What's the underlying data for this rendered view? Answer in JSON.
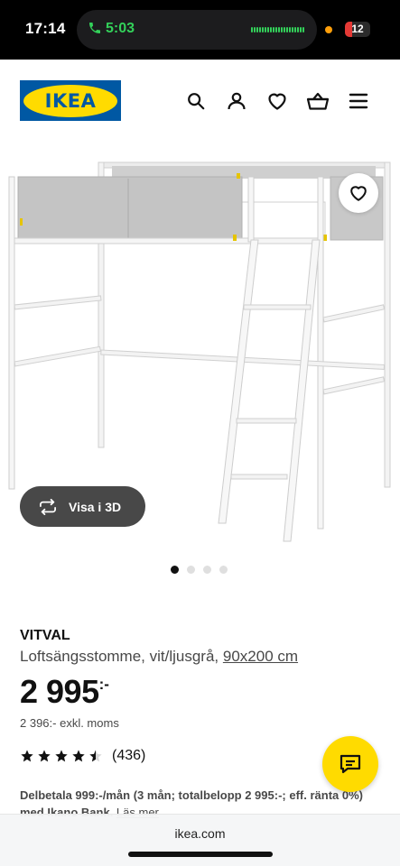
{
  "status_bar": {
    "time": "17:14",
    "call_duration": "5:03",
    "battery": "12"
  },
  "header": {
    "logo_text": "IKEA",
    "icons": [
      "search-icon",
      "profile-icon",
      "heart-icon",
      "basket-icon",
      "menu-icon"
    ]
  },
  "gallery": {
    "view_3d_label": "Visa i 3D",
    "image_count": 4,
    "active_index": 0
  },
  "product": {
    "name": "VITVAL",
    "description": "Loftsängsstomme, vit/ljusgrå, ",
    "size_link": "90x200 cm",
    "price": "2 995",
    "price_suffix": ":-",
    "price_excl_vat": "2 396:- exkl. moms",
    "rating_value": 4.5,
    "rating_count": "(436)",
    "installment_text": "Delbetala 999:-/mån (3 mån; totalbelopp 2 995:-; eff. ränta 0%) med Ikano Bank. ",
    "installment_link": "Läs mer"
  },
  "browser": {
    "url": "ikea.com"
  },
  "colors": {
    "ikea_blue": "#0058a3",
    "ikea_yellow": "#ffdb00",
    "button_dark": "#484848"
  }
}
